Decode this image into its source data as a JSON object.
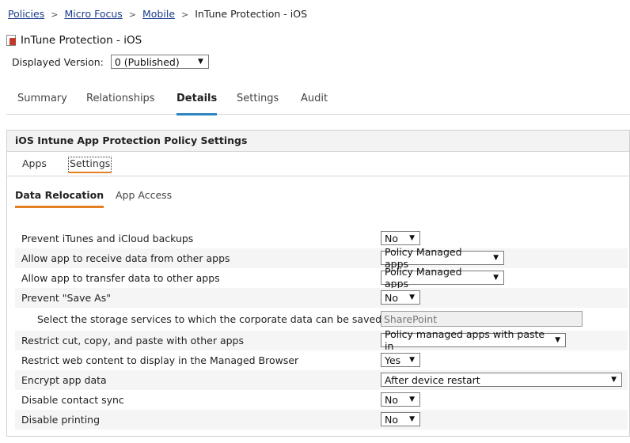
{
  "breadcrumb": {
    "items": [
      "Policies",
      "Micro Focus",
      "Mobile"
    ],
    "current": "InTune Protection - iOS"
  },
  "page": {
    "title": "InTune Protection - iOS",
    "version_label": "Displayed Version:",
    "version_value": "0 (Published)"
  },
  "main_tabs": [
    "Summary",
    "Relationships",
    "Details",
    "Settings",
    "Audit"
  ],
  "main_tab_active": "Details",
  "panel": {
    "header": "iOS Intune App Protection Policy Settings",
    "sub_tabs": [
      "Apps",
      "Settings"
    ],
    "sub_tab_active": "Settings",
    "section_tabs": [
      "Data Relocation",
      "App Access"
    ],
    "section_tab_active": "Data Relocation"
  },
  "settings": [
    {
      "label": "Prevent iTunes and iCloud backups",
      "value": "No"
    },
    {
      "label": "Allow app to receive data from other apps",
      "value": "Policy Managed apps"
    },
    {
      "label": "Allow app to transfer data to other apps",
      "value": "Policy Managed apps"
    },
    {
      "label": "Prevent \"Save As\"",
      "value": "No"
    },
    {
      "label": "Select the storage services to which the corporate data can be saved",
      "value": "SharePoint"
    },
    {
      "label": "Restrict cut, copy, and paste with other apps",
      "value": "Policy managed apps with paste in"
    },
    {
      "label": "Restrict web content to display in the Managed Browser",
      "value": "Yes"
    },
    {
      "label": "Encrypt app data",
      "value": "After device restart"
    },
    {
      "label": "Disable contact sync",
      "value": "No"
    },
    {
      "label": "Disable printing",
      "value": "No"
    }
  ],
  "colors": {
    "link": "#1a3c8c",
    "active_main_tab": "#2e86c1",
    "active_section_tab": "#e67e22"
  }
}
